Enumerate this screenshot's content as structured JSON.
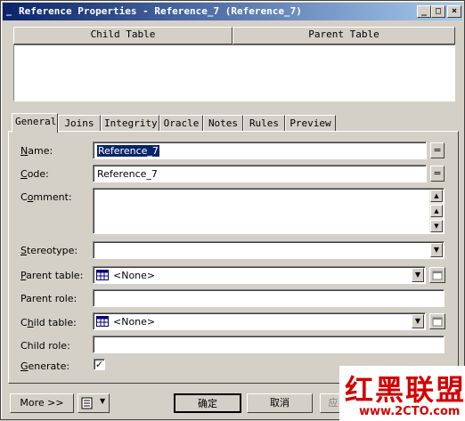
{
  "window": {
    "title": "Reference Properties - Reference_7 (Reference_7)",
    "sys_icon": "_",
    "minimize": "_",
    "maximize": "□",
    "close": "×"
  },
  "grid": {
    "columns": [
      "Child Table",
      "Parent Table"
    ]
  },
  "tabs": [
    {
      "label": "General",
      "active": true
    },
    {
      "label": "Joins",
      "active": false
    },
    {
      "label": "Integrity",
      "active": false
    },
    {
      "label": "Oracle",
      "active": false
    },
    {
      "label": "Notes",
      "active": false
    },
    {
      "label": "Rules",
      "active": false
    },
    {
      "label": "Preview",
      "active": false
    }
  ],
  "form": {
    "name_label": "Name:",
    "name_value": "Reference_7",
    "code_label": "Code:",
    "code_value": "Reference_7",
    "comment_label": "Comment:",
    "comment_value": "",
    "stereotype_label": "Stereotype:",
    "stereotype_value": "",
    "parent_table_label": "Parent table:",
    "parent_table_value": "<None>",
    "parent_role_label": "Parent role:",
    "parent_role_value": "",
    "child_table_label": "Child table:",
    "child_table_value": "<None>",
    "child_role_label": "Child role:",
    "child_role_value": "",
    "generate_label": "Generate:",
    "generate_checked": true,
    "eq_label": "="
  },
  "footer": {
    "more_label": "More >>",
    "ok_label": "确定",
    "cancel_label": "取消",
    "apply_label": "应"
  },
  "watermark": {
    "logo_text": "红黑联盟",
    "url": "www.2CTO.com"
  },
  "colors": {
    "title_start": "#0a246a",
    "title_end": "#a6caf0",
    "face": "#d4d0c8",
    "watermark": "#d40000"
  }
}
